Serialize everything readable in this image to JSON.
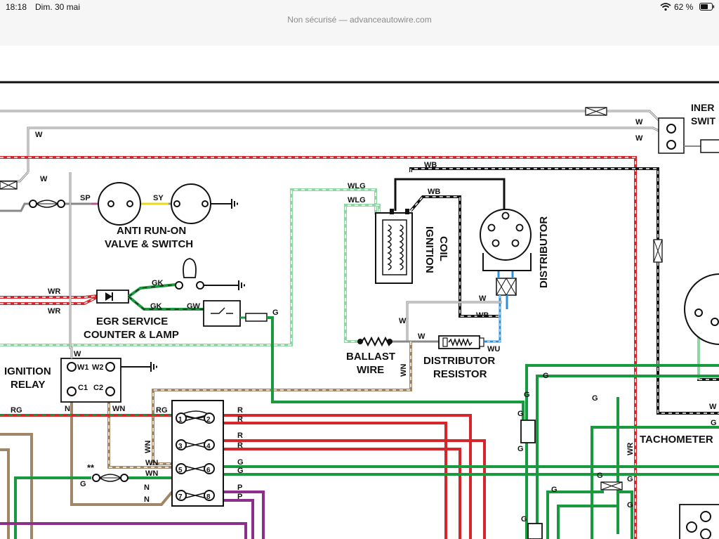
{
  "status": {
    "time": "18:18",
    "date": "Dim. 30 mai",
    "battery_percent": "62 %"
  },
  "browser": {
    "url_text": "Non sécurisé — advanceautowire.com"
  },
  "diagram": {
    "components": {
      "anti_runon_line1": "ANTI RUN-ON",
      "anti_runon_line2": "VALVE & SWITCH",
      "egr_line1": "EGR SERVICE",
      "egr_line2": "COUNTER & LAMP",
      "ignition_relay_line1": "IGNITION",
      "ignition_relay_line2": "RELAY",
      "ignition_coil_line1": "IGNITION",
      "ignition_coil_line2": "COIL",
      "distributor": "DISTRIBUTOR",
      "ballast_line1": "BALLAST",
      "ballast_line2": "WIRE",
      "dist_resistor_line1": "DISTRIBUTOR",
      "dist_resistor_line2": "RESISTOR",
      "inertia_line1": "INER",
      "inertia_line2": "SWIT",
      "tachometer": "TACHOMETER",
      "double_star": "**"
    },
    "wires": {
      "W": "W",
      "WLG": "WLG",
      "WB": "WB",
      "SP": "SP",
      "SY": "SY",
      "WR": "WR",
      "GK": "GK",
      "GW": "GW",
      "G": "G",
      "WU": "WU",
      "WN": "WN",
      "RG": "RG",
      "R": "R",
      "N": "N",
      "P": "P"
    },
    "relay_pins": {
      "W1": "W1",
      "W2": "W2",
      "C1": "C1",
      "C2": "C2"
    },
    "connector_pins": [
      "1",
      "2",
      "3",
      "4",
      "5",
      "6",
      "7",
      "8"
    ],
    "colors": {
      "red": "#d6262b",
      "green": "#1a9a3f",
      "tan": "#a08768",
      "purple": "#8b2f8a",
      "black": "#111111",
      "grey": "#888888",
      "yellow": "#e8d81c",
      "blue": "#2b90d9",
      "pink": "#b05a8a",
      "light_green": "#8fd6a5"
    }
  }
}
